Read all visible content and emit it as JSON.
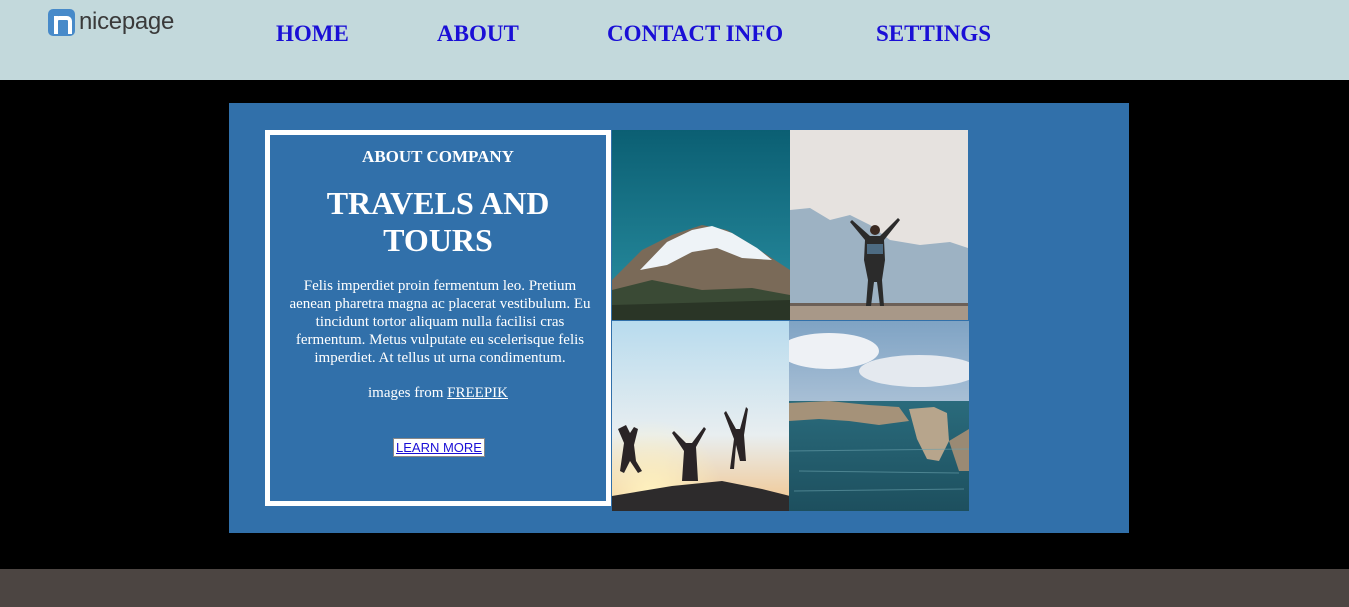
{
  "header": {
    "logo_text": "nicepage",
    "nav": [
      {
        "label": "HOME"
      },
      {
        "label": "ABOUT"
      },
      {
        "label": "CONTACT INFO"
      },
      {
        "label": "SETTINGS"
      }
    ]
  },
  "about": {
    "subtitle": "ABOUT COMPANY",
    "title": "TRAVELS AND TOURS",
    "body": "Felis imperdiet proin fermentum leo. Pretium aenean pharetra magna ac placerat vestibulum. Eu tincidunt tortor aliquam nulla facilisi cras fermentum. Metus vulputate eu scelerisque felis imperdiet. At tellus ut urna condimentum.",
    "credit_prefix": "images from",
    "credit_link": "FREEPIK",
    "button_label": "LEARN MORE"
  },
  "colors": {
    "header_bg": "#c3d9dc",
    "panel_bg": "#3170aa",
    "nav_link": "#1a0fd6",
    "footer_bg": "#4c4542"
  }
}
